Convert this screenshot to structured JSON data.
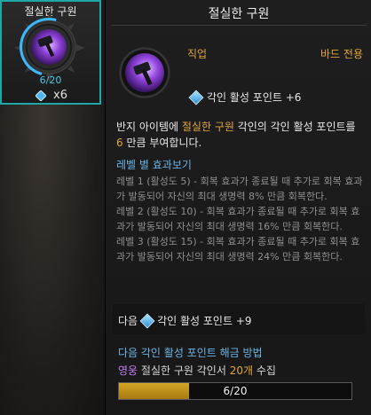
{
  "card": {
    "title": "절실한 구원",
    "count": "6/20",
    "quantity": "x6",
    "icon": "hammer-icon"
  },
  "tooltip": {
    "title": "절실한 구원",
    "job_label": "직업",
    "job_value": "바드 전용",
    "stat_text": "각인 활성 포인트 +6",
    "desc_pre": "반지 아이템에 ",
    "desc_hl1": "절실한 구원",
    "desc_mid": " 각인의 각인 활성 포인트를 ",
    "desc_hl2": "6",
    "desc_post": " 만큼 부여합니다.",
    "effect_title": "레벨 별 효과보기",
    "effects": [
      "레벨 1 (활성도 5) - 회복 효과가 종료될 때 추가로 회복 효과가 발동되어 자신의 최대 생명력 8% 만큼 회복한다.",
      "레벨 2 (활성도 10) - 회복 효과가 종료될 때 추가로 회복 효과가 발동되어 자신의 최대 생명력 16% 만큼 회복한다.",
      "레벨 3 (활성도 15) - 회복 효과가 종료될 때 추가로 회복 효과가 발동되어 자신의 최대 생명력 24% 만큼 회복한다."
    ],
    "next_label": "다음",
    "next_stat": "각인 활성 포인트 +9",
    "method_title": "다음 각인 활성 포인트 해금 방법",
    "collect_grade": "영웅",
    "collect_item": "절실한 구원 각인서",
    "collect_count": "20개",
    "collect_suffix": "수집",
    "progress_text": "6/20",
    "progress_fraction": 0.3
  },
  "colors": {
    "accent_teal": "#1fa6a6",
    "gold": "#e0a63a",
    "blue": "#6db4e6",
    "purple": "#c07cf0"
  }
}
